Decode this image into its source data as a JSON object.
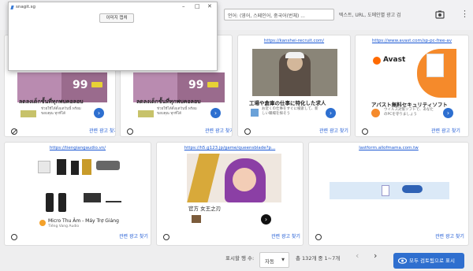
{
  "toolbar": {
    "language_box": "언어: (영어, 스페인어, 중국어(번체) ...",
    "search_placeholder": "텍스트, URL, 도메인별 광고 검"
  },
  "overlay": {
    "app_title": "snagit.sg",
    "capture_button": "이미지 캡쳐"
  },
  "cards": [
    {
      "domain": "",
      "headline": "ลดลงเด็กชั้นที่ทุกพบคอลอบ",
      "sub": "ช่วยใช้ได้ตั้งแต่วันนี้ พร้อม ขอบคุณ ทุกที่ได้",
      "badge": "99",
      "report": "관련 광고 찾기"
    },
    {
      "domain": "",
      "headline": "ลดลงเด็กชั้นที่ทุกพบคอลอบ",
      "sub": "ช่วยใช้ได้ตั้งแต่วันนี้ พร้อม ขอบคุณ ทุกที่ได้",
      "badge": "99",
      "report": "관련 광고 찾기"
    },
    {
      "domain": "https://kanshei-recruit.com/",
      "headline": "工場や倉庫の仕事に特化した求人",
      "sub": "お近くの仕事をすぐに検索して、新しい職場を探そう",
      "report": "관련 광고 찾기"
    },
    {
      "domain": "https://www.avast.com/sp-pc-free-av",
      "brand": "Avast",
      "headline": "アバスト無料セキュリティソフト",
      "sub": "ウイルス対策ソフトで、あなたのPCを守りましょう",
      "report": "관련 광고 찾기"
    },
    {
      "domain": "https://tiengiangaudio.vn/",
      "headline": "Micro Thu Âm - Máy Trợ Giảng",
      "sub": "Tiếng Vang Audio",
      "report": "관련 광고 찾기"
    },
    {
      "domain": "https://h5.g123.jp/game/queensblade?p...",
      "headline": "官方 女王之刃",
      "report": "관련 광고 찾기"
    },
    {
      "domain": "lastform.allofmama.com.tw",
      "report": "관련 광고 찾기"
    }
  ],
  "pager": {
    "rows_label": "표시할 행 수:",
    "rows_value": "자동",
    "range": "총 132개 중 1~7개",
    "show_all": "모두 검토됨으로 표시"
  }
}
